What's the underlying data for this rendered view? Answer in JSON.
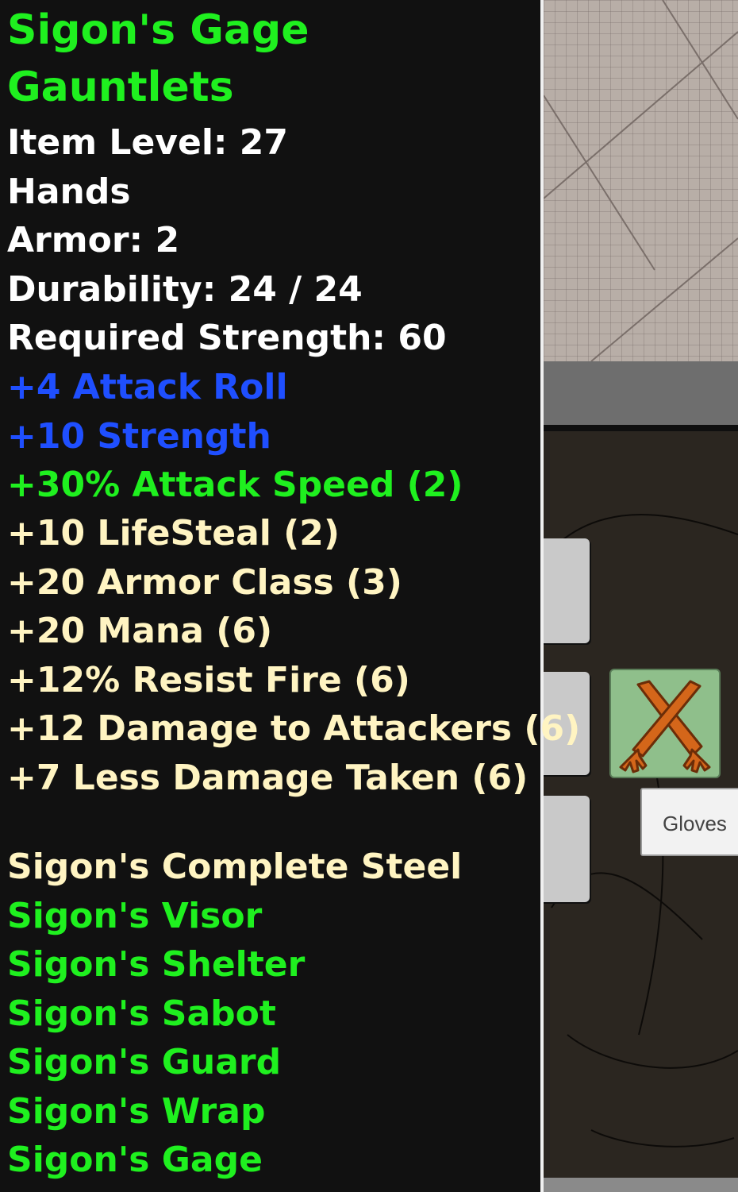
{
  "item": {
    "name_line1": "Sigon's Gage",
    "name_line2": "Gauntlets",
    "item_level": "Item Level: 27",
    "slot": "Hands",
    "armor": "Armor: 2",
    "durability": "Durability: 24 / 24",
    "required_strength": "Required Strength: 60"
  },
  "magic_affixes": [
    "+4 Attack Roll",
    "+10 Strength"
  ],
  "set_bonuses": [
    "+30% Attack Speed (2)",
    "+10 LifeSteal (2)",
    "+20 Armor Class (3)",
    "+20 Mana (6)",
    "+12% Resist Fire (6)",
    "+12 Damage to Attackers (6)",
    "+7 Less Damage Taken (6)"
  ],
  "set": {
    "name": "Sigon's Complete Steel",
    "pieces": [
      "Sigon's Visor",
      "Sigon's Shelter",
      "Sigon's Sabot",
      "Sigon's Guard",
      "Sigon's Wrap",
      "Sigon's Gage"
    ]
  },
  "equipment_tooltip": {
    "label": "Gloves"
  },
  "colors": {
    "set_item_green": "#1ff01f",
    "magic_blue": "#1f4fff",
    "set_bonus_cream": "#fff4c2",
    "base_white": "#ffffff",
    "panel_background": "#111111"
  },
  "icons": {
    "equipped_item": "gloves-icon"
  }
}
